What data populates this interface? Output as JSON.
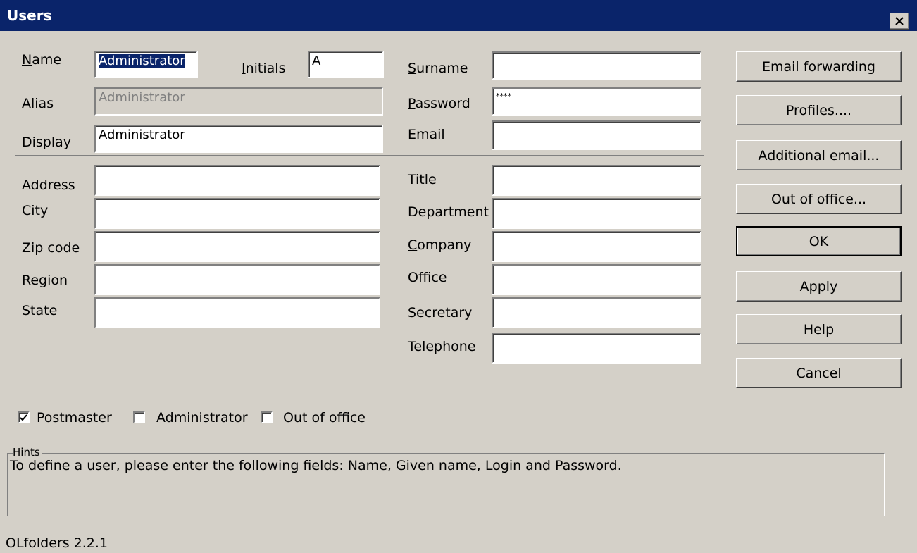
{
  "window": {
    "title": "Users"
  },
  "fields": {
    "name": {
      "label_u": "N",
      "label_rest": "ame",
      "value": "Administrator"
    },
    "initials": {
      "label_u": "I",
      "label_rest": "nitials",
      "value": "A"
    },
    "surname": {
      "label_u": "S",
      "label_rest": "urname",
      "value": ""
    },
    "alias": {
      "label": "Alias",
      "value": "Administrator"
    },
    "password": {
      "label_u": "P",
      "label_rest": "assword",
      "value": "****"
    },
    "display": {
      "label": "Display",
      "value": "Administrator"
    },
    "email": {
      "label": "Email",
      "value": ""
    },
    "address": {
      "label": "Address",
      "value": ""
    },
    "title": {
      "label": "Title",
      "value": ""
    },
    "city": {
      "label": "City",
      "value": ""
    },
    "department": {
      "label": "Department",
      "value": ""
    },
    "zip": {
      "label": "Zip code",
      "value": ""
    },
    "company": {
      "label_u": "C",
      "label_rest": "ompany",
      "value": ""
    },
    "region": {
      "label": "Region",
      "value": ""
    },
    "office": {
      "label": "Office",
      "value": ""
    },
    "state": {
      "label": "State",
      "value": ""
    },
    "secretary": {
      "label": "Secretary",
      "value": ""
    },
    "telephone": {
      "label": "Telephone",
      "value": ""
    }
  },
  "buttons": {
    "email_forwarding": "Email forwarding",
    "profiles": "Profiles....",
    "additional_email": "Additional email...",
    "out_of_office": "Out of office...",
    "ok": "OK",
    "apply": "Apply",
    "help": "Help",
    "cancel": "Cancel"
  },
  "checkboxes": {
    "postmaster": {
      "label": "Postmaster",
      "checked": true
    },
    "administrator": {
      "label": "Administrator",
      "checked": false
    },
    "out_of_office": {
      "label": "Out of office",
      "checked": false
    }
  },
  "hints": {
    "legend": "Hints",
    "text": "To define a user, please enter the following fields: Name, Given name, Login and Password."
  },
  "footer": {
    "version": "OLfolders 2.2.1"
  },
  "colors": {
    "titlebar": "#0a246a",
    "face": "#d4d0c8",
    "selection": "#0a246a"
  }
}
